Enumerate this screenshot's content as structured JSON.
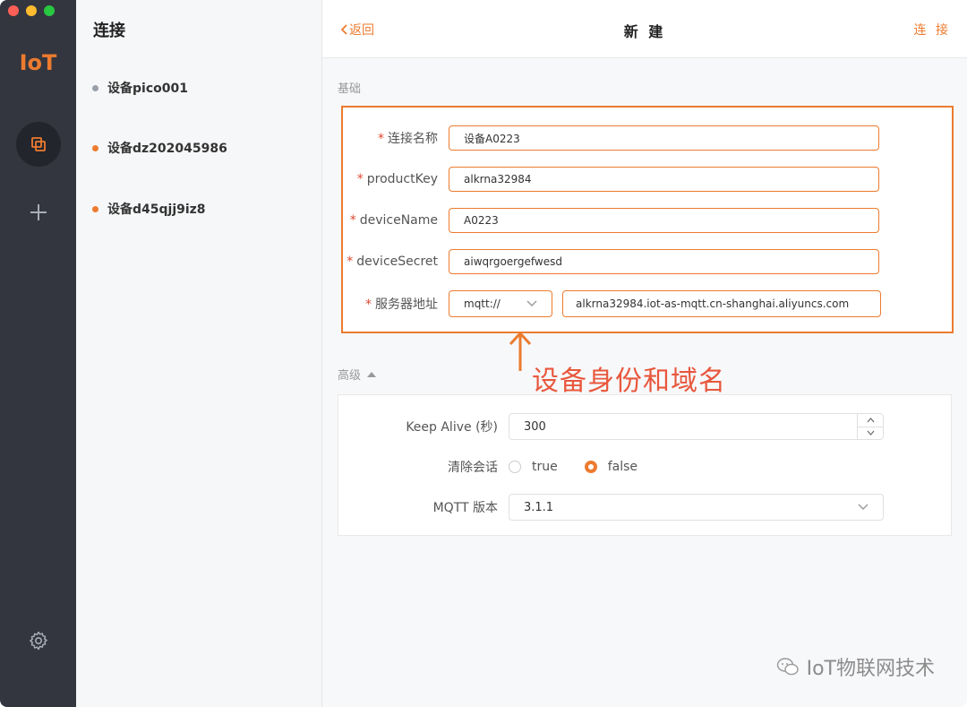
{
  "sidebar": {
    "brand": "IoT"
  },
  "connections": {
    "title": "连接",
    "items": [
      {
        "label": "设备pico001",
        "status": "grey"
      },
      {
        "label": "设备dz202045986",
        "status": "orange"
      },
      {
        "label": "设备d45qjj9iz8",
        "status": "orange"
      }
    ]
  },
  "header": {
    "back_label": "返回",
    "title": "新 建",
    "connect_label": "连 接"
  },
  "basic": {
    "section_label": "基础",
    "required_mark": "*",
    "fields": {
      "name": {
        "label": "连接名称",
        "value": "设备A0223"
      },
      "product_key": {
        "label": "productKey",
        "value": "alkrna32984"
      },
      "device_name": {
        "label": "deviceName",
        "value": "A0223"
      },
      "device_secret": {
        "label": "deviceSecret",
        "value": "aiwqrgoergefwesd"
      },
      "server": {
        "label": "服务器地址",
        "protocol": "mqtt://",
        "host": "alkrna32984.iot-as-mqtt.cn-shanghai.aliyuncs.com"
      }
    }
  },
  "annotation": "设备身份和域名",
  "advanced": {
    "section_label": "高级",
    "keep_alive": {
      "label": "Keep Alive (秒)",
      "value": "300"
    },
    "clean_session": {
      "label": "清除会话",
      "options": [
        "true",
        "false"
      ],
      "selected": "false"
    },
    "mqtt_version": {
      "label": "MQTT 版本",
      "value": "3.1.1"
    }
  },
  "watermark": "IoT物联网技术",
  "colors": {
    "accent": "#ed7b2f",
    "rail": "#33363f",
    "annotation": "#e8573c"
  }
}
